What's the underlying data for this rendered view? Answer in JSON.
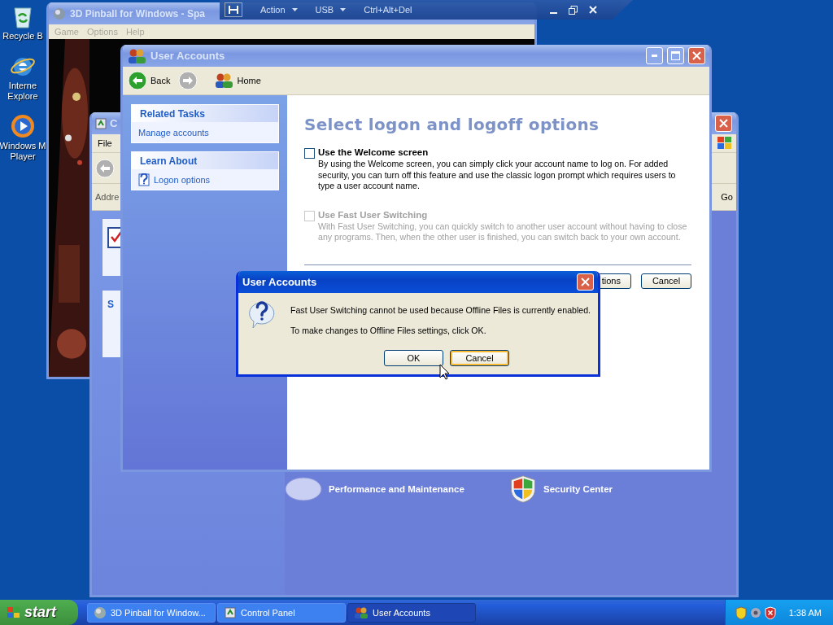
{
  "desktop_icons": [
    {
      "kind": "recycle",
      "lines": [
        "Recycle B"
      ]
    },
    {
      "kind": "browser",
      "lines": [
        "Interne",
        "Explore"
      ]
    },
    {
      "kind": "media",
      "lines": [
        "Windows M",
        "Player"
      ]
    }
  ],
  "remote_toolbar": {
    "menus": [
      {
        "label": "Action",
        "dropdown": true
      },
      {
        "label": "USB",
        "dropdown": true
      },
      {
        "label": "Ctrl+Alt+Del",
        "dropdown": false
      }
    ]
  },
  "pinball_window": {
    "title": "3D Pinball for Windows - Spa",
    "active": false,
    "menu": [
      {
        "label": "Game",
        "disabled": true
      },
      {
        "label": "Options",
        "disabled": true
      },
      {
        "label": "Help",
        "disabled": true
      }
    ]
  },
  "control_panel_window": {
    "title": "C",
    "active": false,
    "menu": [
      "File"
    ],
    "address_label": "Addre",
    "go_button": "Go",
    "side_panel_title": "S",
    "categories": [
      {
        "label": "Performance and Maintenance",
        "kind": "performance"
      },
      {
        "label": "Security Center",
        "kind": "security"
      }
    ]
  },
  "user_accounts_window": {
    "title": "User Accounts",
    "active": false,
    "toolbar": [
      {
        "kind": "back",
        "label": "Back",
        "disabled": false
      },
      {
        "kind": "forward",
        "disabled": true
      },
      {
        "kind": "home",
        "label": "Home"
      }
    ],
    "sidebar": [
      {
        "title": "Related Tasks",
        "items": [
          {
            "kind": "link",
            "label": "Manage accounts"
          }
        ]
      },
      {
        "title": "Learn About",
        "items": [
          {
            "kind": "help",
            "label": "Logon options"
          }
        ]
      }
    ],
    "heading": "Select logon and logoff options",
    "options": [
      {
        "label": "Use the Welcome screen",
        "checked": false,
        "disabled": false,
        "description": "By using the Welcome screen, you can simply click your account name to log on. For added security, you can turn off this feature and use the classic logon prompt which requires users to type a user account name."
      },
      {
        "label": "Use Fast User Switching",
        "checked": false,
        "disabled": true,
        "description": "With Fast User Switching, you can quickly switch to another user account without having to close any programs. Then, when the other user is finished, you can switch back to your own account."
      }
    ],
    "buttons": [
      {
        "label": "tions"
      },
      {
        "label": "Cancel"
      }
    ]
  },
  "dialog": {
    "title": "User Accounts",
    "active": true,
    "messages": [
      "Fast User Switching cannot be used because Offline Files is currently enabled.",
      "To make changes to Offline Files settings, click OK."
    ],
    "buttons": [
      {
        "label": "OK",
        "focused": false
      },
      {
        "label": "Cancel",
        "focused": true
      }
    ]
  },
  "taskbar": {
    "start": "start",
    "tasks": [
      {
        "kind": "pinball",
        "label": "3D Pinball for Window...",
        "selected": false
      },
      {
        "kind": "control",
        "label": "Control Panel",
        "selected": false
      },
      {
        "kind": "users",
        "label": "User Accounts",
        "selected": true
      }
    ],
    "clock": "1:38 AM"
  }
}
